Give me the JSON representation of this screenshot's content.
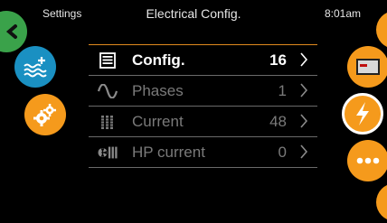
{
  "header": {
    "back_label": "Settings",
    "title": "Electrical Config.",
    "time": "8:01am"
  },
  "left_buttons": [
    {
      "icon": "back-arrow-icon",
      "color": "#3aa24a"
    },
    {
      "icon": "water-plus-icon",
      "color": "#1a90c2"
    },
    {
      "icon": "gears-icon",
      "color": "#f59a1c"
    }
  ],
  "right_buttons": [
    {
      "icon": "unknown-icon",
      "color": "#f59a1c"
    },
    {
      "icon": "screen-icon",
      "color": "#f59a1c"
    },
    {
      "icon": "lightning-icon",
      "color": "#f59a1c"
    },
    {
      "icon": "more-icon",
      "color": "#f59a1c"
    },
    {
      "icon": "unknown-icon",
      "color": "#f59a1c"
    }
  ],
  "menu": {
    "rows": [
      {
        "label": "Config.",
        "value": "16",
        "icon": "config-list-icon"
      },
      {
        "label": "Phases",
        "value": "1",
        "icon": "sine-wave-icon"
      },
      {
        "label": "Current",
        "value": "48",
        "icon": "battery-bars-icon"
      },
      {
        "label": "HP current",
        "value": "0",
        "icon": "heat-pump-icon"
      }
    ]
  },
  "colors": {
    "accent": "#f59a1c",
    "active_text": "#ffffff",
    "dim_text": "#7a7a7a"
  }
}
